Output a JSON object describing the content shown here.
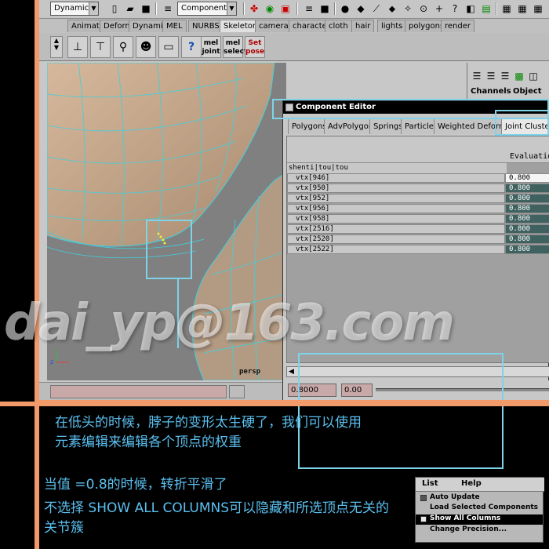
{
  "toolbar": {
    "menu_set": "Dynamics",
    "selection_mode": "Components"
  },
  "shelf_tabs": [
    "Animate",
    "Deform",
    "Dynamic",
    "MEL",
    "NURBS",
    "Skeleton",
    "cameras",
    "character",
    "cloth",
    "hair",
    "lights",
    "polygons",
    "render"
  ],
  "shelf_active_tab": "Skeleton",
  "shelf_buttons": {
    "mel_joint_top": "mel",
    "mel_joint_bottom": "joint",
    "mel_select_top": "mel",
    "mel_select_bottom": "select",
    "set_pose_top": "Set",
    "set_pose_bottom": "pose",
    "help": "?"
  },
  "channel_box": {
    "channels_label": "Channels",
    "object_label": "Object"
  },
  "viewport": {
    "camera_label": "persp"
  },
  "component_editor": {
    "title": "Component Editor",
    "tabs": [
      "Polygons",
      "AdvPolygons",
      "Springs",
      "Particles",
      "Weighted Deformers",
      "Joint Clusters"
    ],
    "active_tab": "Joint Clusters",
    "eval_column_label": "Evaluation",
    "group_name": "shenti|tou|tou",
    "rows": [
      {
        "name": "vtx[946]",
        "value": "0.800"
      },
      {
        "name": "vtx[950]",
        "value": "0.800"
      },
      {
        "name": "vtx[952]",
        "value": "0.800"
      },
      {
        "name": "vtx[956]",
        "value": "0.800"
      },
      {
        "name": "vtx[958]",
        "value": "0.800"
      },
      {
        "name": "vtx[2516]",
        "value": "0.800"
      },
      {
        "name": "vtx[2520]",
        "value": "0.800"
      },
      {
        "name": "vtx[2522]",
        "value": "0.800"
      }
    ],
    "field_value": "0.8000",
    "field_min": "0.00"
  },
  "watermark": "dai_yp@163.com",
  "captions": {
    "line1": "在低头的时候，脖子的变形太生硬了，我们可以使用",
    "line2": "元素编辑来编辑各个顶点的权重",
    "line3": "当值 =0.8的时候，转折平滑了",
    "line4": "不选择 SHOW ALL COLUMNS可以隐藏和所选顶点无关的",
    "line5": "关节簇"
  },
  "popup": {
    "menu_list": "List",
    "menu_help": "Help",
    "items": [
      "Auto Update",
      "Load Selected Components",
      "Show All Columns",
      "Change Precision..."
    ]
  },
  "colors": {
    "orange_border": "#f29a6a",
    "annotation_cyan": "#7fd3e8",
    "caption_blue": "#5bc0f0",
    "weight_cell": "#3f6260"
  }
}
